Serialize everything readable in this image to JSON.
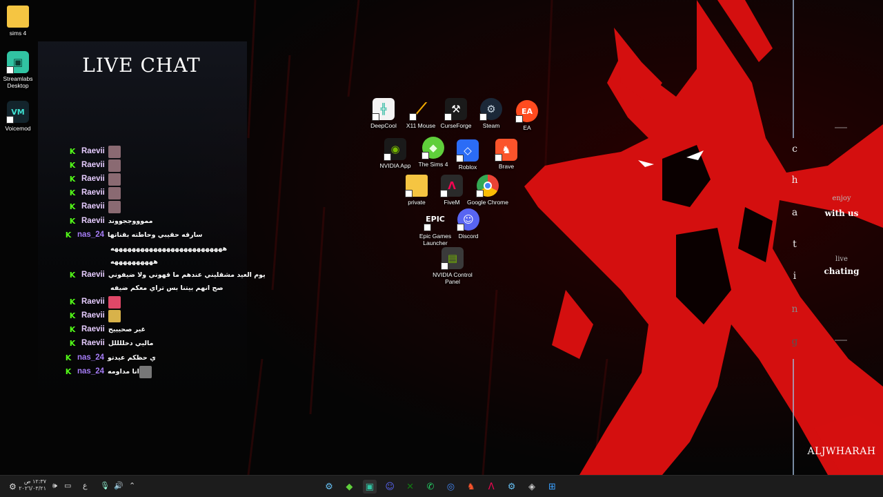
{
  "desktop_icons_left": [
    {
      "label": "sims 4",
      "icon": "folder-icon",
      "color": "#f5c542"
    },
    {
      "label": "Streamlabs Desktop",
      "icon": "streamlabs-icon",
      "color": "#31c3a2"
    },
    {
      "label": "Voicemod",
      "icon": "voicemod-icon",
      "color": "#13242c"
    }
  ],
  "desktop_icons_center": [
    {
      "label": "DeepCool",
      "icon": "deepcool-icon",
      "color": "#f3f3f3"
    },
    {
      "label": "X11 Mouse",
      "icon": "x11-mouse-icon",
      "color": "#f2a900"
    },
    {
      "label": "CurseForge",
      "icon": "curseforge-icon",
      "color": "#1a1a1a"
    },
    {
      "label": "Steam",
      "icon": "steam-icon",
      "color": "#1b2838"
    },
    {
      "label": "EA",
      "icon": "ea-icon",
      "color": "#ff4b1f"
    },
    {
      "label": "NVIDIA App",
      "icon": "nvidia-icon",
      "color": "#76b900"
    },
    {
      "label": "The Sims 4",
      "icon": "sims-icon",
      "color": "#5fcf3b"
    },
    {
      "label": "Roblox",
      "icon": "roblox-icon",
      "color": "#2b6cf6"
    },
    {
      "label": "Brave",
      "icon": "brave-icon",
      "color": "#fb542b"
    },
    {
      "label": "private",
      "icon": "folder-icon",
      "color": "#f5c542"
    },
    {
      "label": "FiveM",
      "icon": "fivem-icon",
      "color": "#f40552"
    },
    {
      "label": "Google Chrome",
      "icon": "chrome-icon",
      "color": "#4285f4"
    },
    {
      "label": "Epic Games Launcher",
      "icon": "epic-games-icon",
      "color": "#2a2a2a"
    },
    {
      "label": "Discord",
      "icon": "discord-icon",
      "color": "#5865f2"
    },
    {
      "label": "NVIDIA Control Panel",
      "icon": "nvidia-control-panel-icon",
      "color": "#76b900"
    }
  ],
  "chat": {
    "title": "LIVE CHAT",
    "platform_badge": "K",
    "messages": [
      {
        "user": "Raevii",
        "user_color": "#e6ccff",
        "text": "",
        "emote": "emote-icon",
        "emote_color": "#8a6a72"
      },
      {
        "user": "Raevii",
        "user_color": "#e6ccff",
        "text": "",
        "emote": "emote-icon",
        "emote_color": "#8a6a72"
      },
      {
        "user": "Raevii",
        "user_color": "#e6ccff",
        "text": "",
        "emote": "emote-icon",
        "emote_color": "#8a6a72"
      },
      {
        "user": "Raevii",
        "user_color": "#e6ccff",
        "text": "",
        "emote": "emote-icon",
        "emote_color": "#8a6a72"
      },
      {
        "user": "Raevii",
        "user_color": "#e6ccff",
        "text": "",
        "emote": "emote-icon",
        "emote_color": "#8a6a72"
      },
      {
        "user": "Raevii",
        "user_color": "#e6ccff",
        "text": "مموووججووند",
        "emote": "",
        "emote_color": ""
      },
      {
        "user": "nas_24",
        "user_color": "#a57cf5",
        "text": "سارقه حقيبي وحاطته بقناتها",
        "emote": "",
        "emote_color": ""
      },
      {
        "user": "",
        "user_color": "#ffffff",
        "text": "ههههههههههههههههههههههههههه",
        "emote": "",
        "emote_color": ""
      },
      {
        "user": "",
        "user_color": "#ffffff",
        "text": "ههههههههههه",
        "emote": "",
        "emote_color": ""
      },
      {
        "user": "Raevii",
        "user_color": "#e6ccff",
        "text": "يوم العيد مشقليني عندهم ما قهوني ولا ضيفوني",
        "emote": "",
        "emote_color": ""
      },
      {
        "user": "",
        "user_color": "#ffffff",
        "text": "صح انهم بيتنا بس تراي معكم ضيفه",
        "emote": "",
        "emote_color": ""
      },
      {
        "user": "Raevii",
        "user_color": "#e6ccff",
        "text": "",
        "emote": "emote-icon",
        "emote_color": "#e04868"
      },
      {
        "user": "Raevii",
        "user_color": "#e6ccff",
        "text": "",
        "emote": "emote-icon",
        "emote_color": "#d8b24a"
      },
      {
        "user": "Raevii",
        "user_color": "#e6ccff",
        "text": "غير صحيييح",
        "emote": "",
        "emote_color": ""
      },
      {
        "user": "Raevii",
        "user_color": "#e6ccff",
        "text": "ماليي دخللللل",
        "emote": "",
        "emote_color": ""
      },
      {
        "user": "nas_24",
        "user_color": "#a57cf5",
        "text": "ي حظكم عيدتو",
        "emote": "",
        "emote_color": ""
      },
      {
        "user": "nas_24",
        "user_color": "#a57cf5",
        "text": "انا مداومه",
        "emote": "emote-icon",
        "emote_color": "#777777"
      }
    ]
  },
  "right_strip": {
    "vertical_word": [
      "c",
      "h",
      "a",
      "t",
      "i",
      "n",
      "g"
    ],
    "enjoy": "enjoy",
    "with_us": "with us",
    "live": "live",
    "chating": "chating",
    "signature": "ALJWHARAH"
  },
  "taskbar": {
    "clock_time": "١٢:٣٧ ص",
    "clock_date": "٢٠٢٦/٠٣/٢١",
    "language": "ع",
    "pinned": [
      {
        "icon": "steam-icon",
        "color": "#66c0f4"
      },
      {
        "icon": "sims-icon",
        "color": "#5fcf3b"
      },
      {
        "icon": "streamlabs-icon",
        "color": "#31c3a2"
      },
      {
        "icon": "discord-icon",
        "color": "#5865f2"
      },
      {
        "icon": "xbox-icon",
        "color": "#107c10"
      },
      {
        "icon": "whatsapp-icon",
        "color": "#25d366"
      },
      {
        "icon": "chrome-icon",
        "color": "#4285f4"
      },
      {
        "icon": "brave-icon",
        "color": "#fb542b"
      },
      {
        "icon": "fivem-icon",
        "color": "#f40552"
      },
      {
        "icon": "steam-icon",
        "color": "#66c0f4"
      },
      {
        "icon": "unity-icon",
        "color": "#cccccc"
      },
      {
        "icon": "start-icon",
        "color": "#3aa0ff"
      }
    ]
  },
  "colors": {
    "wallpaper_red": "#d40f0f",
    "chat_badge": "#53fc18",
    "taskbar": "#1c1c1c"
  }
}
